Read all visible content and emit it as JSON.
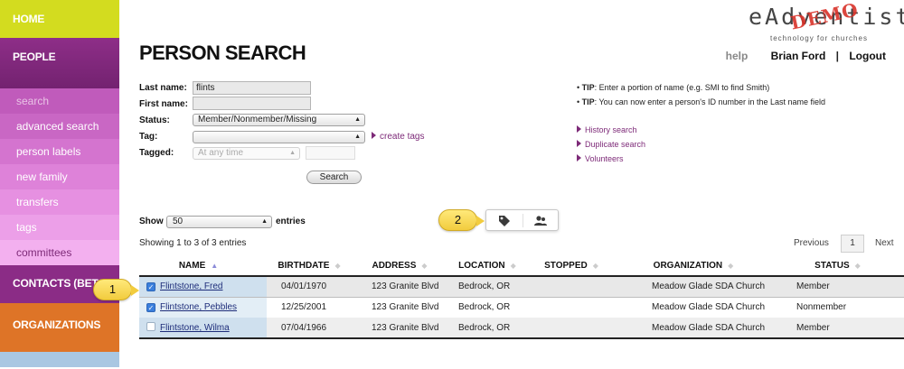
{
  "sidebar": {
    "home": "HOME",
    "people": "PEOPLE",
    "people_items": [
      "search",
      "advanced search",
      "person labels",
      "new family",
      "transfers",
      "tags",
      "committees"
    ],
    "contacts": "CONTACTS (BETA)",
    "organizations": "ORGANIZATIONS"
  },
  "logo": {
    "word": "eAdventist",
    "tagline": "technology for churches",
    "stamp": "DEMO"
  },
  "header": {
    "title": "PERSON SEARCH",
    "help": "help",
    "user": "Brian Ford",
    "separator": "|",
    "logout": "Logout"
  },
  "form": {
    "last_name_label": "Last name:",
    "last_name_value": "flints",
    "first_name_label": "First name:",
    "first_name_value": "",
    "status_label": "Status:",
    "status_value": "Member/Nonmember/Missing",
    "tag_label": "Tag:",
    "tag_value": "",
    "create_tags": "create tags",
    "tagged_label": "Tagged:",
    "tagged_value": "At any time",
    "search_button": "Search"
  },
  "tips": {
    "tip1_label": "TIP",
    "tip1_text": ": Enter a portion of name (e.g. SMI to find Smith)",
    "tip2_label": "TIP",
    "tip2_text": ": You can now enter a person's ID number in the Last name field",
    "links": [
      "History search",
      "Duplicate search",
      "Volunteers"
    ]
  },
  "table_controls": {
    "show_label": "Show",
    "show_value": "50",
    "entries_label": "entries",
    "showing": "Showing 1 to 3 of 3 entries",
    "prev": "Previous",
    "page": "1",
    "next": "Next"
  },
  "callouts": {
    "one": "1",
    "two": "2"
  },
  "action_icons": [
    "tag-icon",
    "people-icon"
  ],
  "table": {
    "columns": [
      "NAME",
      "BIRTHDATE",
      "ADDRESS",
      "LOCATION",
      "STOPPED",
      "ORGANIZATION",
      "STATUS"
    ],
    "rows": [
      {
        "checked": true,
        "name": "Flintstone, Fred",
        "birthdate": "04/01/1970",
        "address": "123 Granite Blvd",
        "location": "Bedrock, OR",
        "stopped": "",
        "organization": "Meadow Glade SDA Church",
        "status": "Member"
      },
      {
        "checked": true,
        "name": "Flintstone, Pebbles",
        "birthdate": "12/25/2001",
        "address": "123 Granite Blvd",
        "location": "Bedrock, OR",
        "stopped": "",
        "organization": "Meadow Glade SDA Church",
        "status": "Nonmember"
      },
      {
        "checked": false,
        "name": "Flintstone, Wilma",
        "birthdate": "07/04/1966",
        "address": "123 Granite Blvd",
        "location": "Bedrock, OR",
        "stopped": "",
        "organization": "Meadow Glade SDA Church",
        "status": "Member"
      }
    ]
  },
  "colors": {
    "people_purple": "#8e2e88",
    "home_green": "#d3dc1f",
    "org_orange": "#de7427",
    "link_purple": "#7d2a78",
    "callout_yellow": "#f2cc3e"
  }
}
